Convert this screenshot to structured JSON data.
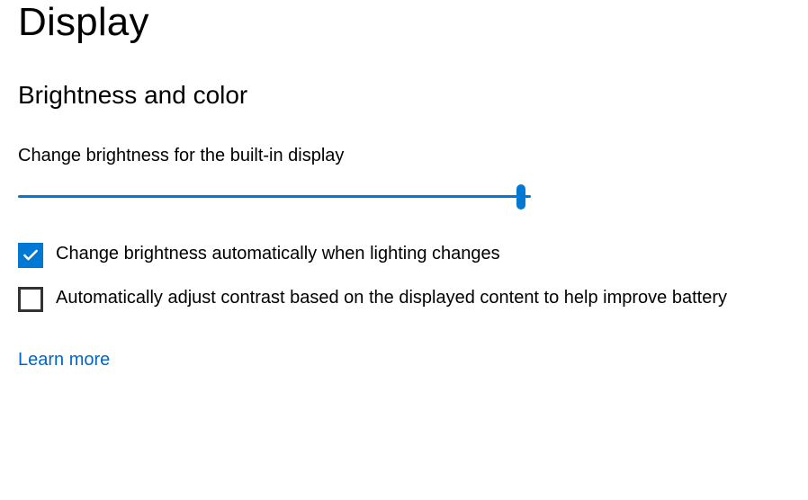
{
  "page": {
    "title": "Display"
  },
  "section": {
    "title": "Brightness and color",
    "brightness_label": "Change brightness for the built-in display",
    "brightness_value": 98,
    "auto_brightness": {
      "label": "Change brightness automatically when lighting changes",
      "checked": true
    },
    "auto_contrast": {
      "label": "Automatically adjust contrast based on the displayed content to help improve battery",
      "checked": false
    },
    "learn_more": "Learn more"
  }
}
